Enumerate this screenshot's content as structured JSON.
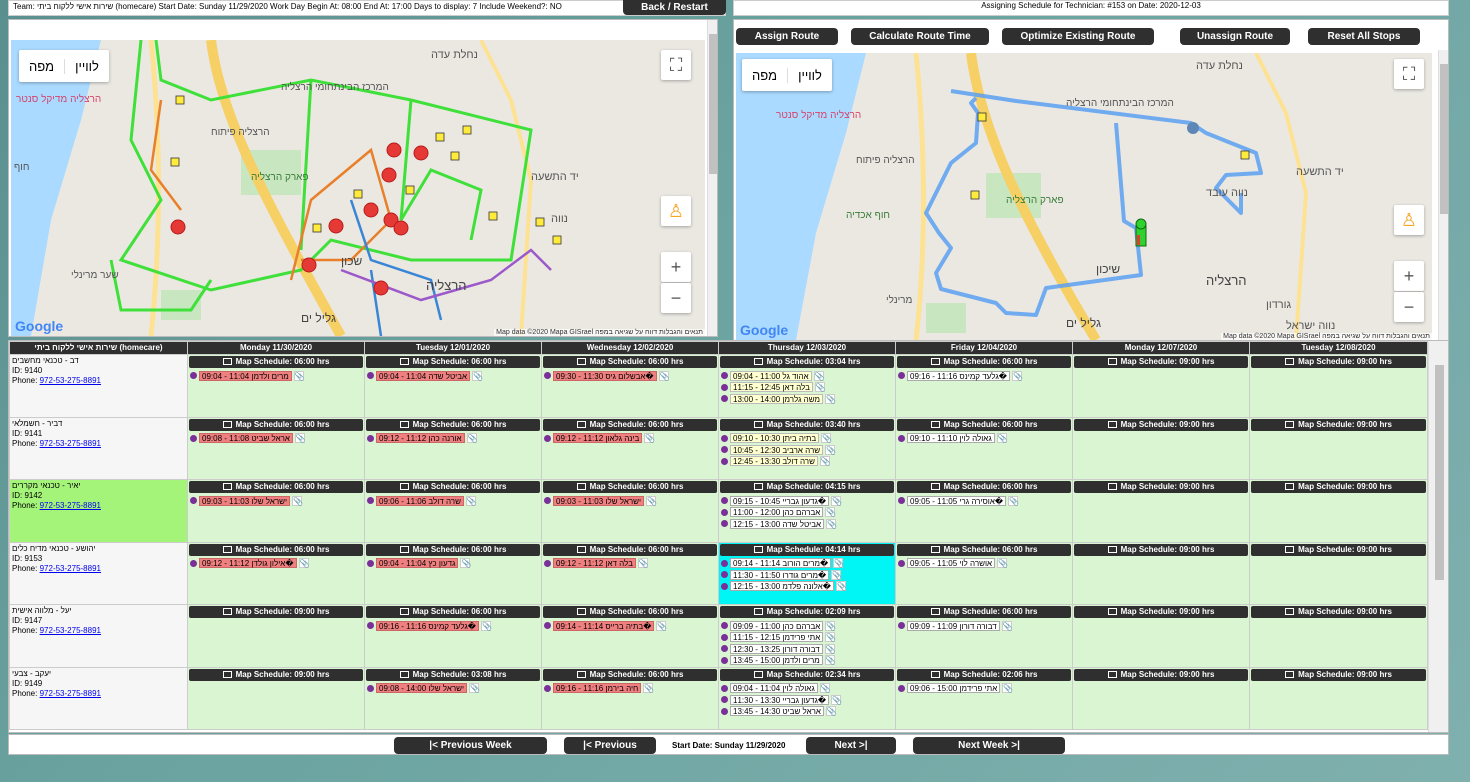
{
  "topbar": {
    "left_text": "Team: שירות אישי ללקוח ביתי (homecare) Start Date: Sunday 11/29/2020 Work Day Begin At: 08:00 End At: 17:00 Days to display: 7 Include Weekend?: NO",
    "back_label": "Back / Restart",
    "right_text": "Assigning Schedule for Technician: #153 on Date: 2020-12-03"
  },
  "route_buttons": {
    "assign": "Assign Route",
    "calculate": "Calculate Route Time",
    "optimize": "Optimize Existing Route",
    "unassign": "Unassign Route",
    "reset": "Reset All Stops"
  },
  "map_left": {
    "type_map": "מפה",
    "type_satellite": "לוויין",
    "zoom_in": "+",
    "zoom_out": "−",
    "fullscreen": "⛶",
    "google": "Google",
    "attribution": "Map data ©2020 Mapa GISrael   תנאים והגבלות   דווח על שגיאה במפה",
    "labels": [
      "נחלת עדה",
      "המרכז הבינתחומי הרצליה",
      "הרצליה מדיקל סנטר",
      "פארק הרצליה",
      "הרצליה פיתוח",
      "שכון",
      "הרצליה",
      "גליל ים",
      "שער מרינלי",
      "יד התשעה",
      "נווה",
      "חוף"
    ]
  },
  "map_right": {
    "type_map": "מפה",
    "type_satellite": "לוויין",
    "zoom_in": "+",
    "zoom_out": "−",
    "fullscreen": "⛶",
    "google": "Google",
    "attribution": "Map data ©2020 Mapa GISrael   תנאים והגבלות   דווח על שגיאה במפה",
    "labels": [
      "נחלת עדה",
      "המרכז הבינתחומי הרצליה",
      "הרצליה מדיקל סנטר",
      "פארק הרצליה",
      "הרצליה פיתוח",
      "שיכון",
      "הרצליה",
      "גליל ים",
      "מרינלי",
      "יד התשעה",
      "נווה עובד",
      "גורדון",
      "נווה ישראל",
      "חוף אכדיה"
    ]
  },
  "schedule": {
    "team_header": "שירות אישי ללקוח ביתי (homecare)",
    "days": [
      "Monday 11/30/2020",
      "Tuesday 12/01/2020",
      "Wednesday 12/02/2020",
      "Thursday 12/03/2020",
      "Friday 12/04/2020",
      "Monday 12/07/2020",
      "Tuesday 12/08/2020"
    ],
    "rows": [
      {
        "name": "דב - טכנאי מחשבים",
        "id": "ID: 9140",
        "phone_label": "Phone:",
        "phone": "972-53-275-8891",
        "highlight": false,
        "cells": [
          {
            "ms": "Map Schedule: 06:00 hrs",
            "appts": [
              {
                "t": "09:04 - 11:04 מרים ולדמן",
                "c": "red"
              }
            ]
          },
          {
            "ms": "Map Schedule: 06:00 hrs",
            "appts": [
              {
                "t": "09:04 - 11:04 אביטל שדה",
                "c": "red"
              }
            ]
          },
          {
            "ms": "Map Schedule: 06:00 hrs",
            "appts": [
              {
                "t": "09:30 - 11:30 אבשלום גיס�",
                "c": "red"
              }
            ]
          },
          {
            "ms": "Map Schedule: 03:04 hrs",
            "appts": [
              {
                "t": "09:04 - 11:00 אהוד גל",
                "c": "yellow"
              },
              {
                "t": "11:15 - 12:45 בלה דאן",
                "c": "yellow"
              },
              {
                "t": "13:00 - 14:00 משה גלרמן",
                "c": "yellow"
              }
            ]
          },
          {
            "ms": "Map Schedule: 06:00 hrs",
            "appts": [
              {
                "t": "09:16 - 11:16 גלעד קמינס�",
                "c": "white"
              }
            ]
          },
          {
            "ms": "Map Schedule: 09:00 hrs",
            "appts": []
          },
          {
            "ms": "Map Schedule: 09:00 hrs",
            "appts": []
          }
        ]
      },
      {
        "name": "דביר - חשמלאי",
        "id": "ID: 9141",
        "phone_label": "Phone:",
        "phone": "972-53-275-8891",
        "highlight": false,
        "cells": [
          {
            "ms": "Map Schedule: 06:00 hrs",
            "appts": [
              {
                "t": "09:08 - 11:08 אראל שביט",
                "c": "red"
              }
            ]
          },
          {
            "ms": "Map Schedule: 06:00 hrs",
            "appts": [
              {
                "t": "09:12 - 11:12 אורנה כהן",
                "c": "red"
              }
            ]
          },
          {
            "ms": "Map Schedule: 06:00 hrs",
            "appts": [
              {
                "t": "09:12 - 11:12 בינה גלאון",
                "c": "red"
              }
            ]
          },
          {
            "ms": "Map Schedule: 03:40 hrs",
            "appts": [
              {
                "t": "09:10 - 10:30 בתיה ביתן",
                "c": "yellow"
              },
              {
                "t": "10:45 - 12:30 שרה ארביב",
                "c": "yellow"
              },
              {
                "t": "12:45 - 13:30 שרה דולב",
                "c": "yellow"
              }
            ]
          },
          {
            "ms": "Map Schedule: 06:00 hrs",
            "appts": [
              {
                "t": "09:10 - 11:10 גאולה לוין",
                "c": "white"
              }
            ]
          },
          {
            "ms": "Map Schedule: 09:00 hrs",
            "appts": []
          },
          {
            "ms": "Map Schedule: 09:00 hrs",
            "appts": []
          }
        ]
      },
      {
        "name": "יאיר - טכנאי מקררים",
        "id": "ID: 9142",
        "phone_label": "Phone:",
        "phone": "972-53-275-8891",
        "highlight": true,
        "cells": [
          {
            "ms": "Map Schedule: 06:00 hrs",
            "appts": [
              {
                "t": "09:03 - 11:03 ישראל שלו",
                "c": "red"
              }
            ]
          },
          {
            "ms": "Map Schedule: 06:00 hrs",
            "appts": [
              {
                "t": "09:06 - 11:06 שרה דולב",
                "c": "red"
              }
            ]
          },
          {
            "ms": "Map Schedule: 06:00 hrs",
            "appts": [
              {
                "t": "09:03 - 11:03 ישראל שלו",
                "c": "red"
              }
            ]
          },
          {
            "ms": "Map Schedule: 04:15 hrs",
            "appts": [
              {
                "t": "09:15 - 10:45 גדעון גבריי�",
                "c": "white"
              },
              {
                "t": "11:00 - 12:00 אברהם כהן",
                "c": "white"
              },
              {
                "t": "12:15 - 13:00 אביטל שדה",
                "c": "white"
              }
            ]
          },
          {
            "ms": "Map Schedule: 06:00 hrs",
            "appts": [
              {
                "t": "09:05 - 11:05 אוסירה גרי�",
                "c": "white"
              }
            ]
          },
          {
            "ms": "Map Schedule: 09:00 hrs",
            "appts": []
          },
          {
            "ms": "Map Schedule: 09:00 hrs",
            "appts": []
          }
        ]
      },
      {
        "name": "יהושע - טכנאי מדיח כלים",
        "id": "ID: 9153",
        "phone_label": "Phone:",
        "phone": "972-53-275-8891",
        "highlight": false,
        "cells": [
          {
            "ms": "Map Schedule: 06:00 hrs",
            "appts": [
              {
                "t": "09:12 - 11:12 אילון גולדן�",
                "c": "red"
              }
            ]
          },
          {
            "ms": "Map Schedule: 06:00 hrs",
            "appts": [
              {
                "t": "09:04 - 11:04 גדעון כץ",
                "c": "red"
              }
            ]
          },
          {
            "ms": "Map Schedule: 06:00 hrs",
            "appts": [
              {
                "t": "09:12 - 11:12 בלה דאן",
                "c": "red"
              }
            ]
          },
          {
            "ms": "Map Schedule: 04:14 hrs",
            "cyan": true,
            "appts": [
              {
                "t": "09:14 - 11:14 מרים הורוב�",
                "c": "white"
              },
              {
                "t": "11:30 - 11:50 מרים גודרו�",
                "c": "white"
              },
              {
                "t": "12:15 - 13:00 אלונה פלדמ�",
                "c": "white"
              }
            ]
          },
          {
            "ms": "Map Schedule: 06:00 hrs",
            "appts": [
              {
                "t": "09:05 - 11:05 אושרה לוי",
                "c": "white"
              }
            ]
          },
          {
            "ms": "Map Schedule: 09:00 hrs",
            "appts": []
          },
          {
            "ms": "Map Schedule: 09:00 hrs",
            "appts": []
          }
        ]
      },
      {
        "name": "יעל - מלווה אישית",
        "id": "ID: 9147",
        "phone_label": "Phone:",
        "phone": "972-53-275-8891",
        "highlight": false,
        "cells": [
          {
            "ms": "Map Schedule: 09:00 hrs",
            "appts": []
          },
          {
            "ms": "Map Schedule: 06:00 hrs",
            "appts": [
              {
                "t": "09:16 - 11:16 גלעד קמינס�",
                "c": "red"
              }
            ]
          },
          {
            "ms": "Map Schedule: 06:00 hrs",
            "appts": [
              {
                "t": "09:14 - 11:14 בתיה ברייס�",
                "c": "red"
              }
            ]
          },
          {
            "ms": "Map Schedule: 02:09 hrs",
            "appts": [
              {
                "t": "09:09 - 11:00 אברהם כהן",
                "c": "white"
              },
              {
                "t": "11:15 - 12:15 אתי פרידמן",
                "c": "white"
              },
              {
                "t": "12:30 - 13:25 דבורה דורון",
                "c": "white"
              },
              {
                "t": "13:45 - 15:00 מרים ולדמן",
                "c": "white"
              }
            ]
          },
          {
            "ms": "Map Schedule: 06:00 hrs",
            "appts": [
              {
                "t": "09:09 - 11:09 דבורה דורון",
                "c": "white"
              }
            ]
          },
          {
            "ms": "Map Schedule: 09:00 hrs",
            "appts": []
          },
          {
            "ms": "Map Schedule: 09:00 hrs",
            "appts": []
          }
        ]
      },
      {
        "name": "יעקב - צבעי",
        "id": "ID: 9149",
        "phone_label": "Phone:",
        "phone": "972-53-275-8891",
        "highlight": false,
        "cells": [
          {
            "ms": "Map Schedule: 09:00 hrs",
            "appts": []
          },
          {
            "ms": "Map Schedule: 03:08 hrs",
            "appts": [
              {
                "t": "09:08 - 14:00 ישראל שלו",
                "c": "red"
              }
            ]
          },
          {
            "ms": "Map Schedule: 06:00 hrs",
            "appts": [
              {
                "t": "09:16 - 11:16 חיה בירמן",
                "c": "red"
              }
            ]
          },
          {
            "ms": "Map Schedule: 02:34 hrs",
            "appts": [
              {
                "t": "09:04 - 11:04 גאולה לוין",
                "c": "white"
              },
              {
                "t": "11:30 - 13:30 גדעון גבריי�",
                "c": "white"
              },
              {
                "t": "13:45 - 14:30 אראל שביט",
                "c": "white"
              }
            ]
          },
          {
            "ms": "Map Schedule: 02:06 hrs",
            "appts": [
              {
                "t": "09:06 - 15:00 אתי פרידמן",
                "c": "white"
              }
            ]
          },
          {
            "ms": "Map Schedule: 09:00 hrs",
            "appts": []
          },
          {
            "ms": "Map Schedule: 09:00 hrs",
            "appts": []
          }
        ]
      }
    ]
  },
  "bottom": {
    "prev_week": "|< Previous Week",
    "prev": "|< Previous",
    "start_date": "Start Date:  Sunday 11/29/2020",
    "next": "Next >|",
    "next_week": "Next Week >|"
  },
  "colors": {
    "dark": "#2f2f2f",
    "cell_green": "#d9f5d2",
    "cell_cyan": "#00f5f5",
    "appt_red": "#f08080",
    "highlight_green": "#a5f47a"
  }
}
